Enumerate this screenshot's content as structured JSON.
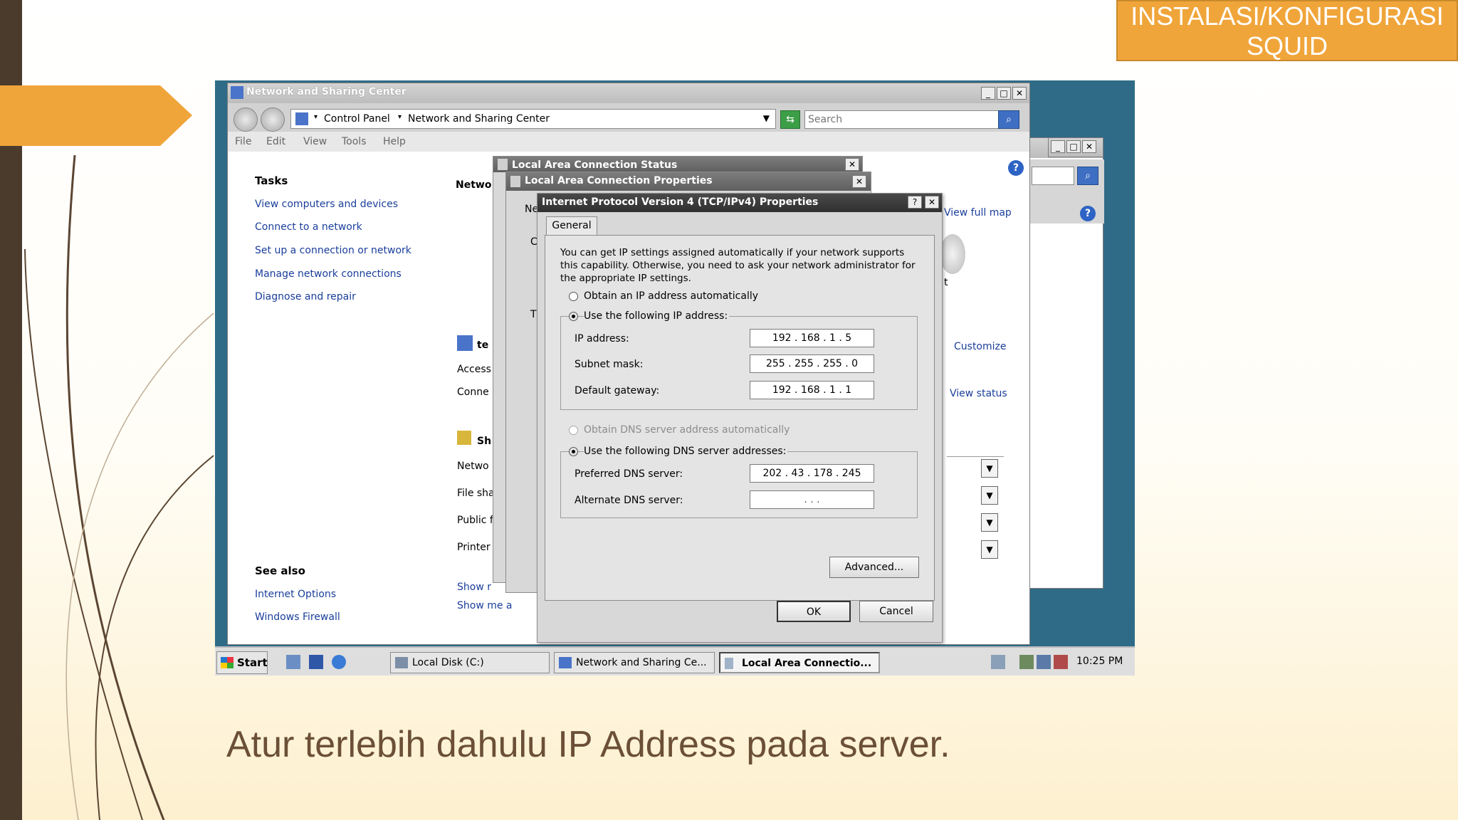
{
  "slide": {
    "title": "INSTALASI/KONFIGURASI SQUID",
    "caption": "Atur terlebih dahulu IP Address pada server."
  },
  "main_window": {
    "title": "Network and Sharing Center",
    "breadcrumb": [
      "Control Panel",
      "Network and Sharing Center"
    ],
    "search_placeholder": "Search",
    "menu": [
      "File",
      "Edit",
      "View",
      "Tools",
      "Help"
    ],
    "tasks_heading": "Tasks",
    "tasks": [
      "View computers and devices",
      "Connect to a network",
      "Set up a connection or network",
      "Manage network connections",
      "Diagnose and repair"
    ],
    "see_also_heading": "See also",
    "see_also": [
      "Internet Options",
      "Windows Firewall"
    ],
    "partial_texts": [
      "Netwo",
      "te",
      "Access",
      "Conne",
      "Sh",
      "Netwo",
      "File sha",
      "Public f",
      "Printer",
      "Show r",
      "Show me a"
    ],
    "right_links": [
      "View full map",
      "Customize",
      "View status"
    ],
    "partial_right": "t"
  },
  "status_dialog": {
    "title": "Local Area Connection Status"
  },
  "properties_dialog": {
    "title": "Local Area Connection Properties",
    "partial": [
      "Ne",
      "C",
      "T"
    ]
  },
  "ipv4_dialog": {
    "title": "Internet Protocol Version 4 (TCP/IPv4) Properties",
    "tab": "General",
    "description": "You can get IP settings assigned automatically if your network supports this capability. Otherwise, you need to ask your network administrator for the appropriate IP settings.",
    "radio_auto_ip": "Obtain an IP address automatically",
    "radio_manual_ip": "Use the following IP address:",
    "ip_label": "IP address:",
    "ip_value": "192 . 168 .   1   .   5",
    "subnet_label": "Subnet mask:",
    "subnet_value": "255 . 255 . 255 .   0",
    "gateway_label": "Default gateway:",
    "gateway_value": "192 . 168 .   1   .   1",
    "radio_auto_dns": "Obtain DNS server address automatically",
    "radio_manual_dns": "Use the following DNS server addresses:",
    "pref_dns_label": "Preferred DNS server:",
    "pref_dns_value": "202 .  43  . 178 . 245",
    "alt_dns_label": "Alternate DNS server:",
    "alt_dns_value": ".         .         .",
    "advanced_button": "Advanced...",
    "ok_button": "OK",
    "cancel_button": "Cancel"
  },
  "taskbar": {
    "start": "Start",
    "tasks": [
      "Local Disk (C:)",
      "Network and Sharing Ce...",
      "Local Area Connectio..."
    ],
    "clock": "10:25 PM"
  }
}
